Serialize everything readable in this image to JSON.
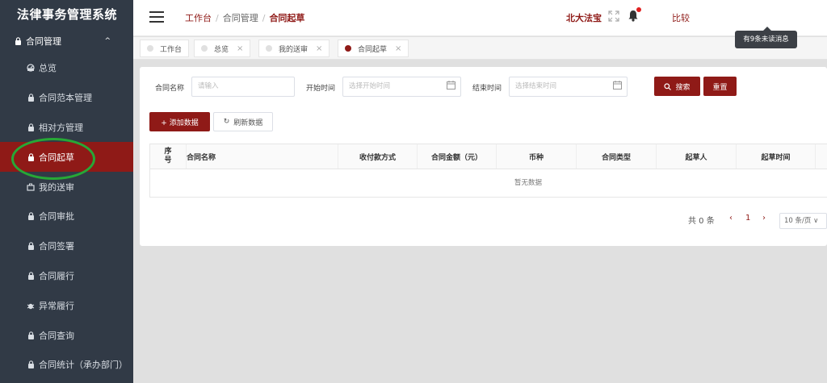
{
  "app": {
    "title": "法律事务管理系统"
  },
  "sidebar": {
    "group": {
      "label": "合同管理",
      "arrow": "^"
    },
    "items": [
      {
        "label": "总览",
        "icon": "gauge-icon"
      },
      {
        "label": "合同范本管理",
        "icon": "lock-icon"
      },
      {
        "label": "相对方管理",
        "icon": "lock-icon"
      },
      {
        "label": "合同起草",
        "icon": "lock-icon",
        "active": true
      },
      {
        "label": "我的送审",
        "icon": "briefcase-icon"
      },
      {
        "label": "合同审批",
        "icon": "lock-icon"
      },
      {
        "label": "合同签署",
        "icon": "lock-icon"
      },
      {
        "label": "合同履行",
        "icon": "lock-icon"
      },
      {
        "label": "异常履行",
        "icon": "bug-icon"
      },
      {
        "label": "合同查询",
        "icon": "lock-icon"
      },
      {
        "label": "合同统计（承办部门）",
        "icon": "lock-icon"
      }
    ]
  },
  "header": {
    "breadcrumb": [
      "工作台",
      "合同管理",
      "合同起草"
    ],
    "user": "北大法宝",
    "compare": "比较",
    "notification_tooltip": "有9条未读消息",
    "accent_color": "#8f1a17"
  },
  "tabs": [
    {
      "label": "工作台",
      "closable": false
    },
    {
      "label": "总览",
      "closable": true
    },
    {
      "label": "我的送审",
      "closable": true
    },
    {
      "label": "合同起草",
      "closable": true,
      "active": true
    }
  ],
  "search": {
    "contract_name_label": "合同名称",
    "contract_name_placeholder": "请输入",
    "start_label": "开始时间",
    "start_placeholder": "选择开始时间",
    "end_label": "结束时间",
    "end_placeholder": "选择结束时间",
    "search_button": "搜索",
    "reset_button": "重置"
  },
  "toolbar": {
    "add_button": "+ 添加数据",
    "refresh_button": "刷新数据"
  },
  "table": {
    "seq_header": [
      "序",
      "号"
    ],
    "columns": [
      "合同名称",
      "收付款方式",
      "合同金额（元）",
      "币种",
      "合同类型",
      "起草人",
      "起草时间"
    ],
    "empty_text": "暂无数据"
  },
  "pagination": {
    "total": "共 0 条",
    "prev": "‹",
    "current_page": "1",
    "next": "›",
    "page_size": "10 条/页 ∨"
  }
}
